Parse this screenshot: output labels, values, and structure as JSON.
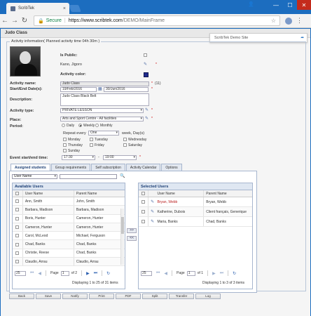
{
  "browser": {
    "tab_title": "ScribTek",
    "tab_close": "×",
    "url_secure_label": "Secure",
    "url_host": "https://www.scribtek.com",
    "url_path": "/DEMO/MainFrame",
    "window_minimize": "—",
    "window_maximize": "☐",
    "window_close": "✕",
    "back_icon": "←",
    "forward_icon": "→",
    "reload_icon": "↻",
    "star_icon": "☆",
    "menu_icon": "⋮",
    "user_icon": "👤"
  },
  "notification": {
    "text": "ScribTek Demo Site"
  },
  "page": {
    "title": "Judo Class",
    "legend": "Activity information( Planned activity time 04h 30m )"
  },
  "form": {
    "is_public_label": "Is Public:",
    "owner_name": "Kano, Jigoro",
    "activity_color_label": "Activity color:",
    "activity_name_label": "Activity name:",
    "activity_name_value": "Judo Class",
    "activity_name_counter": "(11)",
    "dates_label": "Start/End Date(s):",
    "start_date": "19/Feb/2016",
    "end_date": "30/Jun/2016",
    "description_label": "Description:",
    "description_value": "Judo Class Black Belt",
    "activity_type_label": "Activity type:",
    "activity_type_value": "PRIVATE LESSON",
    "place_label": "Place:",
    "place_value": "Arts and Sport Centre - All facilities",
    "period_label": "Period:",
    "period_options": [
      "Daily",
      "Weekly",
      "Monthly"
    ],
    "repeat_every_label": "Repeat every",
    "repeat_every_value": "One",
    "repeat_unit_label": "week, Day(s)",
    "days": [
      "Monday",
      "Tuesday",
      "Wednesday",
      "Thursday",
      "Friday",
      "Saturday",
      "Sunday"
    ],
    "time_label": "Event start/end time:",
    "start_time": "17:30",
    "end_time": "19:00",
    "time_separator": "-"
  },
  "tabs": [
    "Assigned students",
    "Group requirements",
    "Self subscription",
    "Activity Calendar",
    "Options"
  ],
  "search": {
    "field_select": "User Name"
  },
  "available": {
    "title": "Available Users",
    "col_user": "User Name",
    "col_parent": "Parent Name",
    "rows": [
      {
        "user": "Ann, Smith",
        "parent": "John, Smith"
      },
      {
        "user": "Barbara, Madison",
        "parent": "Barbara, Madison"
      },
      {
        "user": "Boris, Hunter",
        "parent": "Cameron, Hunter"
      },
      {
        "user": "Cameron, Hunter",
        "parent": "Cameron, Hunter"
      },
      {
        "user": "Carol, McLeod",
        "parent": "Michael, Ferguson"
      },
      {
        "user": "Chad, Banks",
        "parent": "Chad, Banks"
      },
      {
        "user": "Christie, Reese",
        "parent": "Chad, Banks"
      },
      {
        "user": "Claudio, Arrau",
        "parent": "Claudio, Arrau"
      }
    ],
    "page_size": "25",
    "page_label": "Page",
    "page_value": "1",
    "page_of": "of 2",
    "display": "Displaying 1 to 25 of 31 items"
  },
  "selected": {
    "title": "Selected Users",
    "col_user": "User Name",
    "col_parent": "Parent Name",
    "rows": [
      {
        "user": "Bryan, Webb",
        "parent": "Bryan, Webb",
        "red": true
      },
      {
        "user": "Katherine, Dubois",
        "parent": "Client français, Generique",
        "red": false
      },
      {
        "user": "Maria, Banks",
        "parent": "Chad, Banks",
        "red": false
      }
    ],
    "page_size": "25",
    "page_label": "Page",
    "page_value": "1",
    "page_of": "of 1",
    "display": "Displaying 1 to 3 of 3 items"
  },
  "move": {
    "add": ">>",
    "remove": "<<"
  },
  "bottom_buttons": [
    "Back",
    "Save",
    "Notify",
    "Print",
    "PDF",
    "Split",
    "Transfer",
    "Log"
  ]
}
